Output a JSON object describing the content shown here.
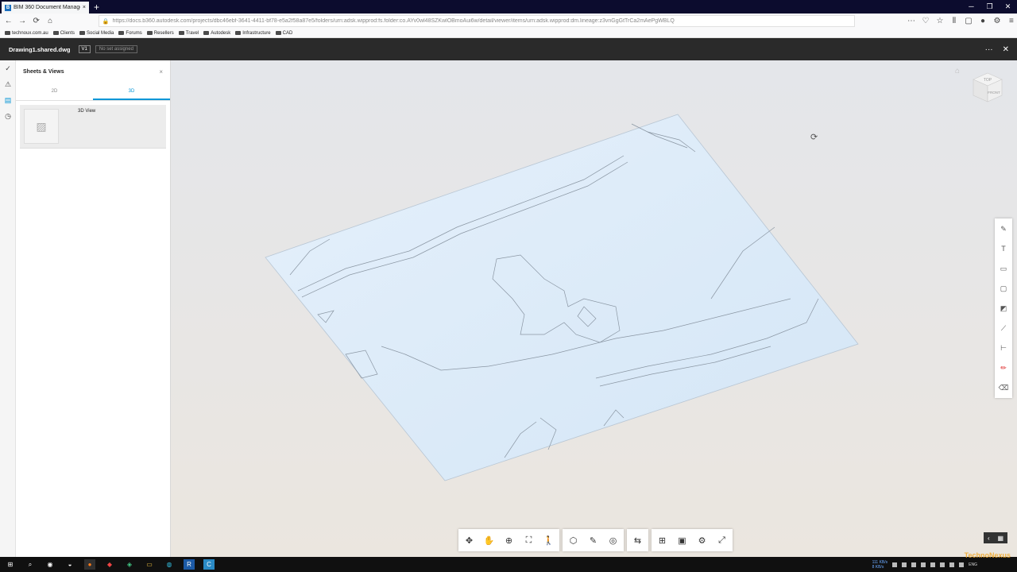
{
  "browser": {
    "tab_title": "BIM 360 Document Manageme...",
    "tab_close": "×",
    "new_tab": "+",
    "url": "https://docs.b360.autodesk.com/projects/dbc46ebf-3641-4411-bf78-e5a2f58a87e5/folders/urn:adsk.wipprod:fs.folder:co.AYv0wl48SZKwlOBmoAui6w/detail/viewer/items/urn:adsk.wipprod:dm.lineage:z3vnGgGtTrCa2mAePgWBLQ",
    "url_icon": "lock-icon",
    "window_controls": [
      "─",
      "❐",
      "✕"
    ],
    "nav_buttons": [
      "←",
      "→",
      "⟳",
      "⌂"
    ],
    "nav_right": [
      "⋯",
      "♡",
      "☆",
      "⦀",
      "▢",
      "●",
      "⚙",
      "≡"
    ],
    "bookmarks": [
      "technoux.com.au",
      "Clients",
      "Social Media",
      "Forums",
      "Resellers",
      "Travel",
      "Autodesk",
      "Infrastructure",
      "CAD"
    ]
  },
  "app": {
    "file_name": "Drawing1.shared.dwg",
    "version": "V1",
    "set_label": "No set assigned",
    "more": "···",
    "close": "✕"
  },
  "left_rail": [
    "✓",
    "⚠",
    "▤",
    "◷"
  ],
  "sheets_panel": {
    "title": "Sheets & Views",
    "close": "×",
    "tabs": [
      "2D",
      "3D"
    ],
    "active_tab": "3D",
    "items": [
      {
        "label": "3D View"
      }
    ]
  },
  "viewer": {
    "surface_color": "#dbeaf8",
    "viewcube_top": "TOP",
    "viewcube_front": "FRONT",
    "home": "⌂"
  },
  "markup_tools": [
    "✎",
    "T",
    "▭",
    "▢",
    "◩",
    "⟋",
    "⊢",
    "✏",
    "⌫"
  ],
  "nav_toolbar": {
    "group1": [
      "✥",
      "✋",
      "⊕",
      "⛶",
      "🚶"
    ],
    "group2": [
      "⬡",
      "✎",
      "◎"
    ],
    "group3": [
      "⇆"
    ],
    "group4": [
      "⊞",
      "▣",
      "⚙",
      "⤢"
    ]
  },
  "mini_ctrl": [
    "‹",
    "▦"
  ],
  "taskbar": {
    "items": [
      "⊞",
      "⌕",
      "◉",
      "◒",
      "●",
      "◆",
      "◈",
      "▭",
      "◍",
      "R",
      "C"
    ],
    "speed_up": "111 KB/s",
    "speed_down": "8 KB/s",
    "lang": "ENG",
    "watermark": "TechnoNexus"
  }
}
